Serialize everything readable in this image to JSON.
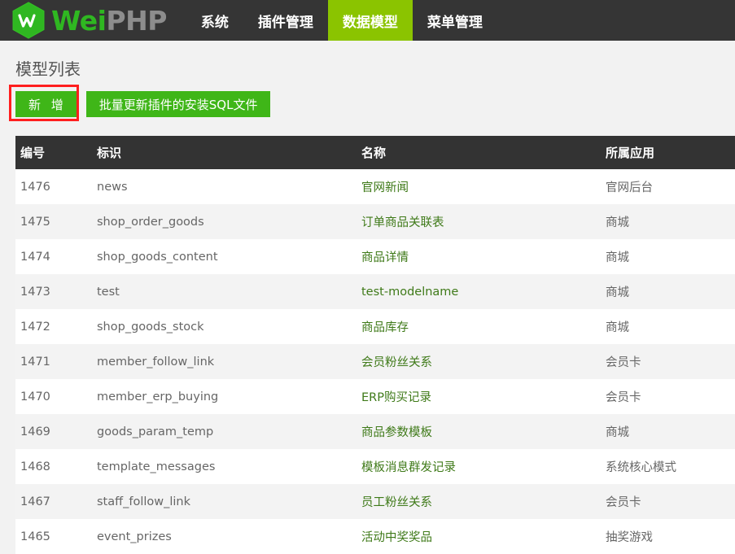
{
  "brand": {
    "name_green": "Wei",
    "name_gray": "PHP",
    "logo_icon": "weiphp-hexagon-logo"
  },
  "nav": {
    "items": [
      {
        "label": "系统",
        "active": false
      },
      {
        "label": "插件管理",
        "active": false
      },
      {
        "label": "数据模型",
        "active": true
      },
      {
        "label": "菜单管理",
        "active": false
      }
    ],
    "active_color": "#8bc400",
    "bar_color": "#353535"
  },
  "page": {
    "title": "模型列表"
  },
  "toolbar": {
    "add_label": "新 增",
    "bulk_label": "批量更新插件的安装SQL文件",
    "button_color": "#3fb618",
    "annotation_color": "#ff1f1f"
  },
  "table": {
    "headers": [
      "编号",
      "标识",
      "名称",
      "所属应用"
    ],
    "link_color": "#3f7a19",
    "rows": [
      {
        "id": "1476",
        "ident": "news",
        "name": "官网新闻",
        "app": "官网后台"
      },
      {
        "id": "1475",
        "ident": "shop_order_goods",
        "name": "订单商品关联表",
        "app": "商城"
      },
      {
        "id": "1474",
        "ident": "shop_goods_content",
        "name": "商品详情",
        "app": "商城"
      },
      {
        "id": "1473",
        "ident": "test",
        "name": "test-modelname",
        "app": "商城"
      },
      {
        "id": "1472",
        "ident": "shop_goods_stock",
        "name": "商品库存",
        "app": "商城"
      },
      {
        "id": "1471",
        "ident": "member_follow_link",
        "name": "会员粉丝关系",
        "app": "会员卡"
      },
      {
        "id": "1470",
        "ident": "member_erp_buying",
        "name": "ERP购买记录",
        "app": "会员卡"
      },
      {
        "id": "1469",
        "ident": "goods_param_temp",
        "name": "商品参数模板",
        "app": "商城"
      },
      {
        "id": "1468",
        "ident": "template_messages",
        "name": "模板消息群发记录",
        "app": "系统核心模式"
      },
      {
        "id": "1467",
        "ident": "staff_follow_link",
        "name": "员工粉丝关系",
        "app": "会员卡"
      },
      {
        "id": "1465",
        "ident": "event_prizes",
        "name": "活动中奖奖品",
        "app": "抽奖游戏"
      }
    ]
  }
}
